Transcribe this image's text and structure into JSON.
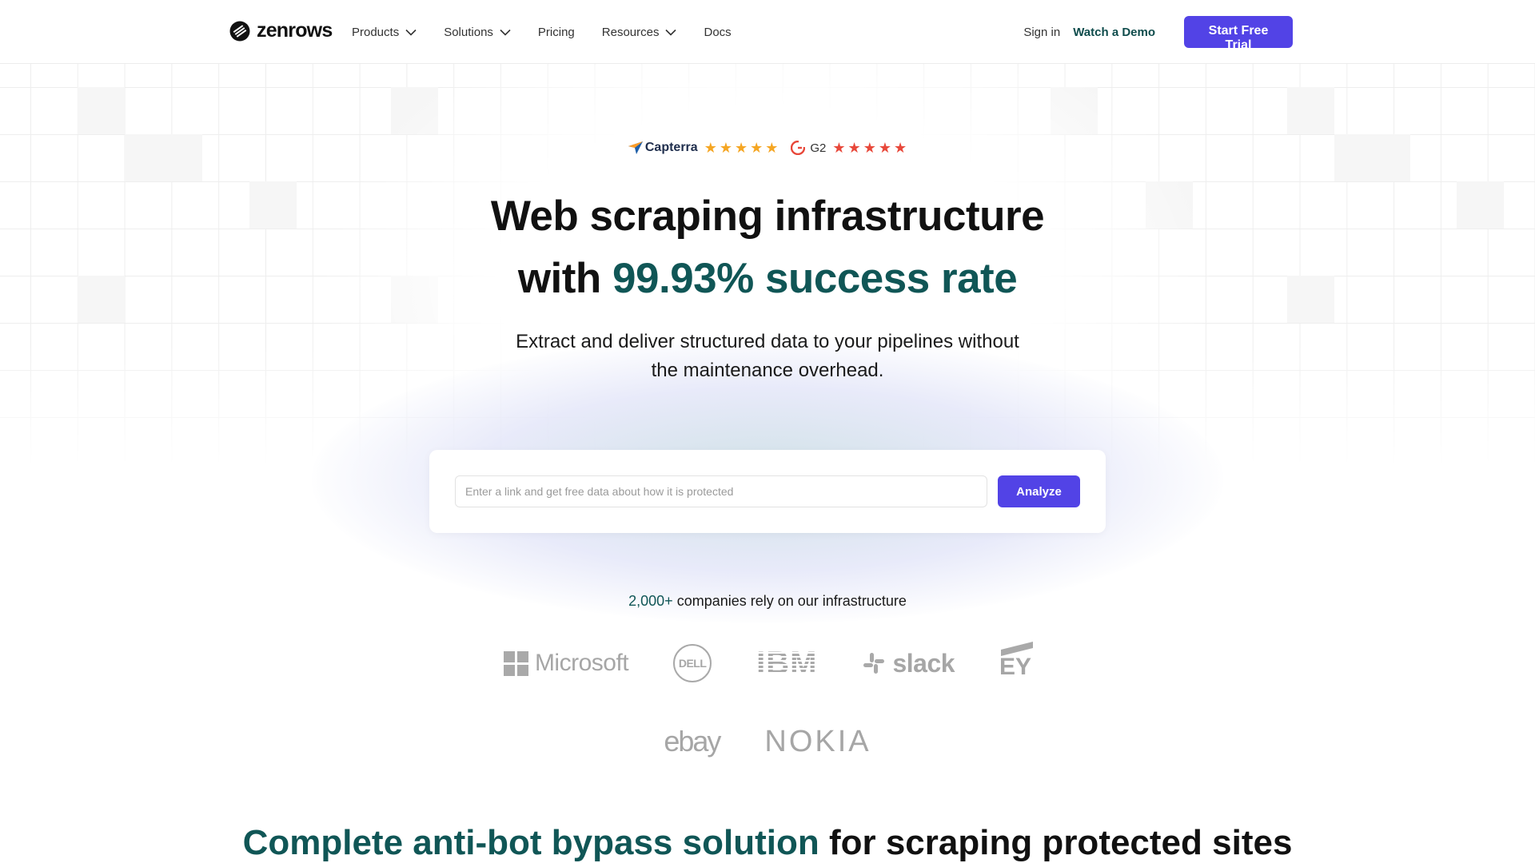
{
  "brand": {
    "name": "zenrows"
  },
  "nav": {
    "items": [
      {
        "label": "Products",
        "has_dropdown": true
      },
      {
        "label": "Solutions",
        "has_dropdown": true
      },
      {
        "label": "Pricing",
        "has_dropdown": false
      },
      {
        "label": "Resources",
        "has_dropdown": true
      },
      {
        "label": "Docs",
        "has_dropdown": false
      }
    ],
    "signin": "Sign in",
    "demo": "Watch a Demo",
    "trial": "Start Free Trial"
  },
  "ratings": {
    "capterra": {
      "name": "Capterra",
      "stars": 5
    },
    "g2": {
      "name": "G2",
      "stars": 5
    }
  },
  "hero": {
    "title_line1": "Web scraping infrastructure",
    "title_line2_prefix": "with ",
    "title_line2_accent": "99.93% success rate",
    "subtitle_line1": "Extract and deliver structured data to your pipelines without",
    "subtitle_line2": "the maintenance overhead."
  },
  "analyze": {
    "placeholder": "Enter a link and get free data about how it is protected",
    "value": "",
    "button": "Analyze"
  },
  "trust": {
    "count": "2,000+",
    "text": " companies rely on our infrastructure"
  },
  "logos": {
    "microsoft": "Microsoft",
    "dell": "DELL",
    "ibm": "IBM",
    "slack": "slack",
    "ey": "EY",
    "ebay": "ebay",
    "nokia": "NOKIA"
  },
  "section": {
    "accent": "Complete anti-bot bypass solution",
    "rest": " for scraping protected sites"
  },
  "colors": {
    "accent_teal": "#105656",
    "primary_button": "#5243e6",
    "star_orange": "#f5a623",
    "star_red": "#e8483a"
  }
}
